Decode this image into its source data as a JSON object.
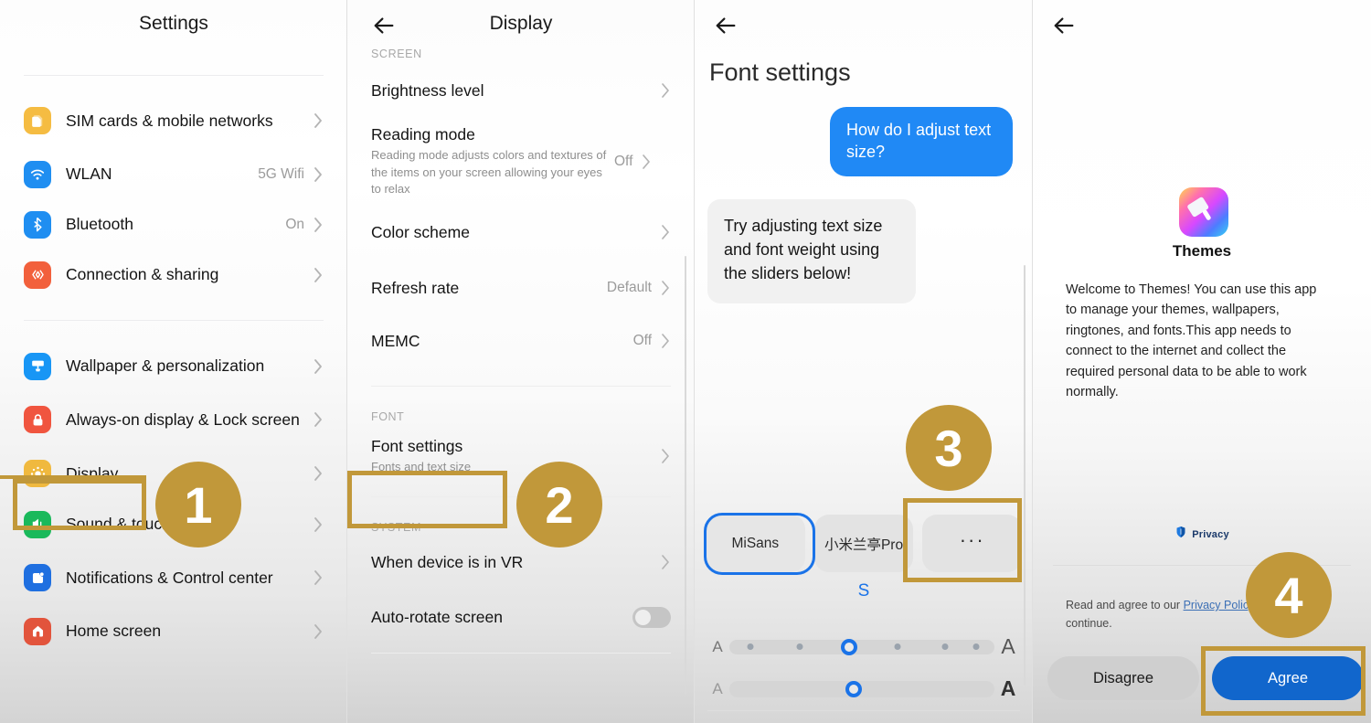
{
  "panels": {
    "settings": {
      "title": "Settings",
      "items": [
        {
          "label": "SIM cards & mobile networks",
          "value": "",
          "icon": "sim-card-icon",
          "color": "#f5bc42"
        },
        {
          "label": "WLAN",
          "value": "5G Wifi",
          "icon": "wifi-icon",
          "color": "#1f8ef1"
        },
        {
          "label": "Bluetooth",
          "value": "On",
          "icon": "bluetooth-icon",
          "color": "#1f8ef1"
        },
        {
          "label": "Connection & sharing",
          "value": "",
          "icon": "connection-sharing-icon",
          "color": "#f2603c"
        },
        {
          "label": "Wallpaper & personalization",
          "value": "",
          "icon": "wallpaper-icon",
          "color": "#1896f5"
        },
        {
          "label": "Always-on display & Lock screen",
          "value": "",
          "icon": "lock-icon",
          "color": "#f0553f"
        },
        {
          "label": "Display",
          "value": "",
          "icon": "display-brightness-icon",
          "color": "#f0b93f"
        },
        {
          "label": "Sound & touch",
          "value": "",
          "icon": "speaker-icon",
          "color": "#1ab95b"
        },
        {
          "label": "Notifications & Control center",
          "value": "",
          "icon": "notifications-icon",
          "color": "#1f6fe0"
        },
        {
          "label": "Home screen",
          "value": "",
          "icon": "home-icon",
          "color": "#e2543c"
        }
      ]
    },
    "display": {
      "title": "Display",
      "back_icon": "back-arrow-icon",
      "sections": [
        {
          "caption": "SCREEN"
        },
        {
          "caption": "FONT"
        },
        {
          "caption": "SYSTEM"
        }
      ],
      "rows": [
        {
          "title": "Brightness level",
          "sub": "",
          "value": "",
          "control": "chevron"
        },
        {
          "title": "Reading mode",
          "sub": "Reading mode adjusts colors and textures of the items on your screen allowing your eyes to relax",
          "value": "Off",
          "control": "chevron"
        },
        {
          "title": "Color scheme",
          "sub": "",
          "value": "",
          "control": "chevron"
        },
        {
          "title": "Refresh rate",
          "sub": "",
          "value": "Default",
          "control": "chevron"
        },
        {
          "title": "MEMC",
          "sub": "",
          "value": "Off",
          "control": "chevron"
        },
        {
          "title": "Font settings",
          "sub": "Fonts and text size",
          "value": "",
          "control": "chevron"
        },
        {
          "title": "When device is in VR",
          "sub": "",
          "value": "",
          "control": "chevron"
        },
        {
          "title": "Auto-rotate screen",
          "sub": "",
          "value": "",
          "control": "toggle-off"
        }
      ]
    },
    "font_settings": {
      "back_icon": "back-arrow-icon",
      "title": "Font settings",
      "chat": [
        {
          "from": "user",
          "text": "How do I adjust text size?"
        },
        {
          "from": "assistant",
          "text": "Try adjusting text size and font weight using the sliders below!"
        }
      ],
      "font_chips": [
        {
          "label": "MiSans",
          "selected": true
        },
        {
          "label": "小米兰亭Pro",
          "selected": false
        },
        {
          "label": "···",
          "selected": false
        }
      ],
      "size_indicator": "S",
      "text_size_slider": {
        "left_glyph": "A",
        "right_glyph": "A",
        "ticks": 6,
        "value_index": 2
      },
      "font_weight_slider": {
        "left_glyph": "A",
        "right_glyph": "A",
        "value_percent": 47
      },
      "accent_color": "#1a73e8"
    },
    "themes": {
      "back_icon": "back-arrow-icon",
      "app_icon": "themes-app-icon",
      "app_name": "Themes",
      "description": "Welcome to Themes! You can use this app to manage your themes, wallpapers, ringtones, and fonts.This app needs to connect to the internet and collect the required personal data to be able to work normally.",
      "privacy_badge": {
        "icon": "privacy-shield-icon",
        "label": "Privacy"
      },
      "note_prefix": "Read and agree to our ",
      "note_link": "Privacy Policy",
      "note_suffix": " to continue.",
      "disagree_label": "Disagree",
      "agree_label": "Agree",
      "agree_color": "#1166cc"
    }
  },
  "annotations": {
    "accent_color": "#C1983A",
    "steps": [
      {
        "number": "1",
        "target": "display-settings-row"
      },
      {
        "number": "2",
        "target": "font-settings-row"
      },
      {
        "number": "3",
        "target": "more-fonts-chip"
      },
      {
        "number": "4",
        "target": "agree-button"
      }
    ]
  }
}
